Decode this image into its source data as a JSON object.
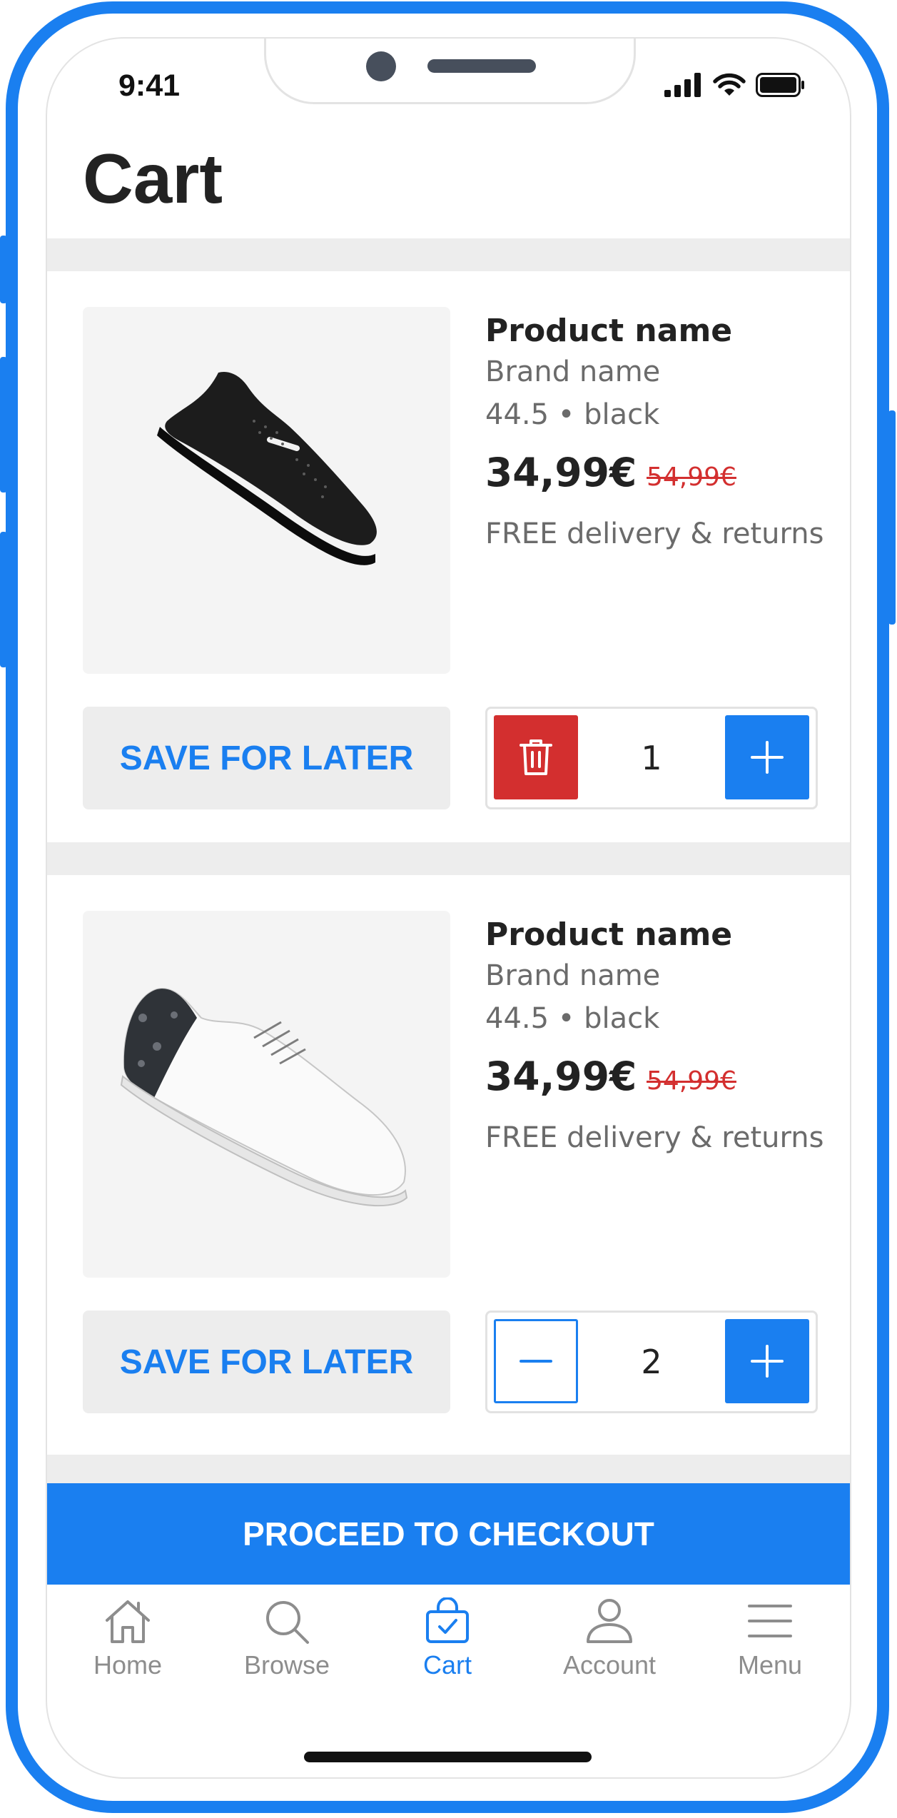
{
  "status_bar": {
    "time": "9:41"
  },
  "page": {
    "title": "Cart"
  },
  "cart_items": [
    {
      "product_name": "Product name",
      "brand": "Brand name",
      "variant": "44.5 • black",
      "price": "34,99€",
      "old_price": "54,99€",
      "delivery": "FREE delivery & returns",
      "image": "black-sneaker",
      "save_label": "SAVE FOR LATER",
      "quantity": "1",
      "left_action": "trash-icon",
      "right_action": "plus-icon"
    },
    {
      "product_name": "Product name",
      "brand": "Brand name",
      "variant": "44.5 • black",
      "price": "34,99€",
      "old_price": "54,99€",
      "delivery": "FREE delivery & returns",
      "image": "white-sneaker",
      "save_label": "SAVE FOR LATER",
      "quantity": "2",
      "left_action": "minus-icon",
      "right_action": "plus-icon"
    }
  ],
  "checkout": {
    "label": "PROCEED TO CHECKOUT"
  },
  "tabs": [
    {
      "label": "Home",
      "icon": "home-icon",
      "active": false
    },
    {
      "label": "Browse",
      "icon": "search-icon",
      "active": false
    },
    {
      "label": "Cart",
      "icon": "bag-icon",
      "active": true
    },
    {
      "label": "Account",
      "icon": "user-icon",
      "active": false
    },
    {
      "label": "Menu",
      "icon": "menu-icon",
      "active": false
    }
  ],
  "colors": {
    "accent": "#1a7ff0",
    "danger": "#d32f2f",
    "text": "#222222",
    "muted": "#6b6b6b"
  }
}
